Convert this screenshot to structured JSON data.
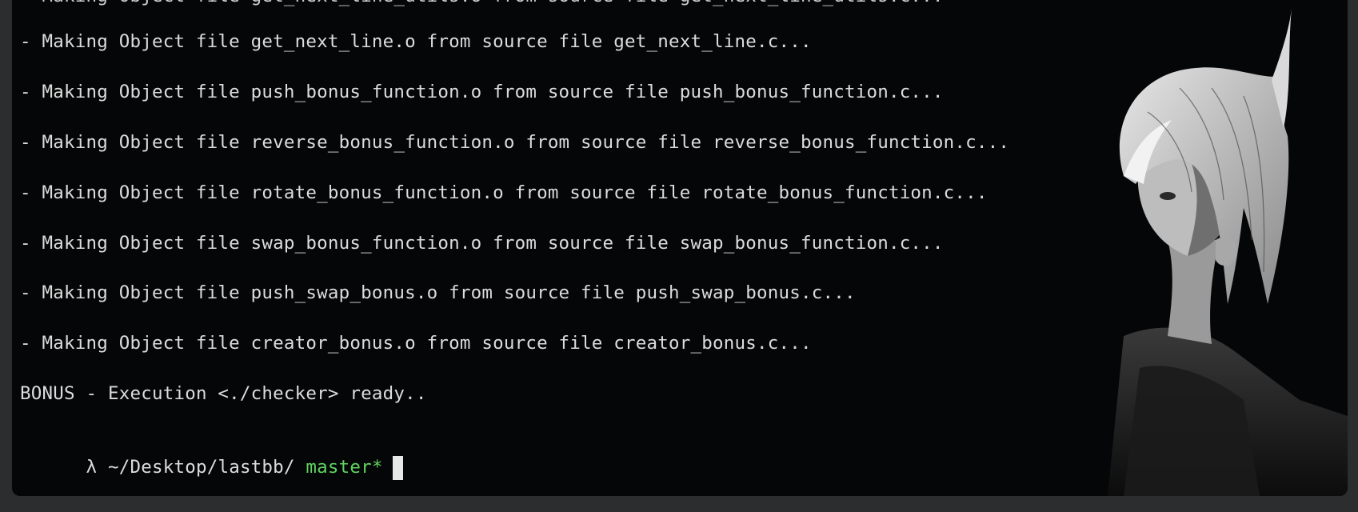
{
  "terminal": {
    "partial_top_line": "- Making Object file get_next_line_utils.o from source file get_next_line_utils.c...",
    "lines": [
      "- Making Object file get_next_line.o from source file get_next_line.c...",
      "- Making Object file push_bonus_function.o from source file push_bonus_function.c...",
      "- Making Object file reverse_bonus_function.o from source file reverse_bonus_function.c...",
      "- Making Object file rotate_bonus_function.o from source file rotate_bonus_function.c...",
      "- Making Object file swap_bonus_function.o from source file swap_bonus_function.c...",
      "- Making Object file push_swap_bonus.o from source file push_swap_bonus.c...",
      "- Making Object file creator_bonus.o from source file creator_bonus.c..."
    ],
    "ready_line": "BONUS - Execution <./checker> ready..",
    "prompt": {
      "symbol": "λ",
      "path": "~/Desktop/lastbb/",
      "branch": "master*"
    }
  },
  "background": {
    "image": "anime-character-illustration"
  },
  "colors": {
    "background": "#050607",
    "text": "#dcdcdc",
    "branch": "#5fd35f"
  }
}
